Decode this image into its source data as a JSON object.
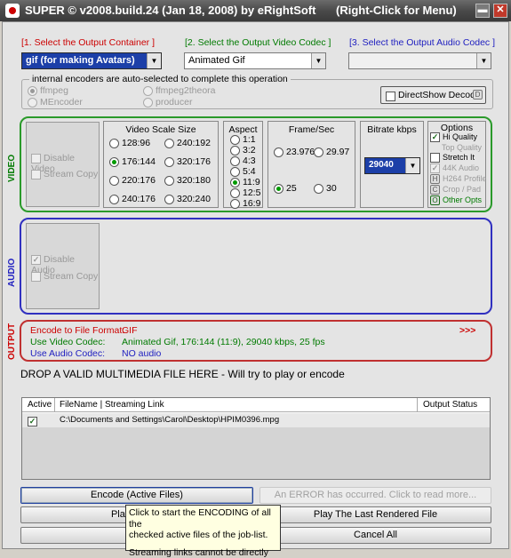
{
  "titlebar": {
    "title": "SUPER © v2008.build.24 (Jan 18, 2008) by eRightSoft",
    "hint": "(Right-Click for Menu)",
    "minimize": "▬",
    "close": "✕"
  },
  "container": {
    "label": "[1.     Select the Output Container ]",
    "value": "gif  (for making Avatars)"
  },
  "video_codec": {
    "label": "[2.  Select the Output Video Codec ]",
    "value": "Animated Gif"
  },
  "audio_codec": {
    "label": "[3.  Select the Output Audio Codec ]",
    "value": ""
  },
  "encoders": {
    "legend": "internal encoders are auto-selected to complete this operation",
    "items": [
      "ffmpeg",
      "ffmpeg2theora",
      "MEncoder",
      "producer"
    ],
    "directshow_label": "DirectShow Decode",
    "directshow_badge": "D"
  },
  "video": {
    "side_label": "VIDEO",
    "disable_video": "Disable Video",
    "stream_copy": "Stream Copy",
    "scale": {
      "title": "Video Scale Size",
      "options": [
        "128:96",
        "240:192",
        "176:144",
        "320:176",
        "220:176",
        "320:180",
        "240:176",
        "320:240"
      ],
      "selected": "176:144"
    },
    "aspect": {
      "title": "Aspect",
      "options": [
        "1:1",
        "3:2",
        "4:3",
        "5:4",
        "11:9",
        "12:5",
        "16:9"
      ],
      "selected": "11:9"
    },
    "fps": {
      "title": "Frame/Sec",
      "options": [
        "23.976",
        "29.97",
        "25",
        "30"
      ],
      "selected": "25"
    },
    "bitrate": {
      "title": "Bitrate  kbps",
      "value": "29040"
    },
    "options": {
      "title": "Options",
      "hi_quality": "Hi Quality",
      "top_quality": "Top Quality",
      "stretch": "Stretch It",
      "audio_44k": "44K Audio",
      "h264": "H264 Profile",
      "crop": "Crop / Pad",
      "other": "Other Opts",
      "badge_h": "H",
      "badge_c": "C",
      "badge_o": "O"
    }
  },
  "audio": {
    "side_label": "AUDIO",
    "disable_audio": "Disable Audio",
    "stream_copy": "Stream Copy"
  },
  "output": {
    "side_label": "OUTPUT",
    "rows": [
      {
        "label": "Encode to File Format:",
        "value": "GIF"
      },
      {
        "label": "Use Video Codec:",
        "value": "Animated Gif,  176:144 (11:9),  29040 kbps,  25 fps"
      },
      {
        "label": "Use Audio Codec:",
        "value": "NO audio"
      }
    ],
    "more": ">>>"
  },
  "drop_text": "DROP A VALID MULTIMEDIA FILE HERE - Will try to play or encode",
  "joblist": {
    "col_active": "Active",
    "col_file": "FileName  |  Streaming Link",
    "col_status": "Output Status",
    "rows": [
      {
        "file": "C:\\Documents and Settings\\Carol\\Desktop\\HPIM0396.mpg",
        "status": ""
      }
    ]
  },
  "buttons": {
    "encode": "Encode (Active Files)",
    "error": "An ERROR has occurred. Click to read more...",
    "play_active": "Play (Active",
    "play_last": "Play The Last Rendered File",
    "play3": "Playe",
    "cancel": "Cancel All"
  },
  "tooltip": {
    "line1": "Click to start the ENCODING of all the",
    "line2": "checked active files of the job-list.",
    "line3": "Streaming links cannot be directly"
  }
}
